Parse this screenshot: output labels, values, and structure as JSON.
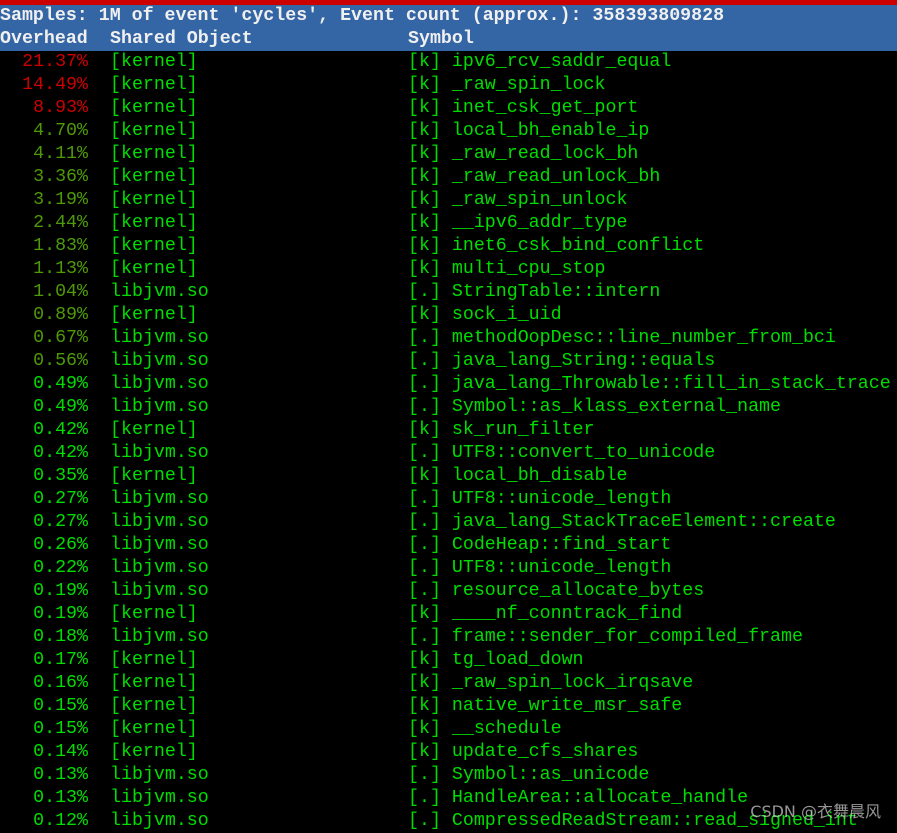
{
  "header": {
    "summary": "Samples: 1M of event 'cycles', Event count (approx.): 358393809828",
    "columns": [
      "Overhead",
      "Shared Object",
      "Symbol"
    ]
  },
  "colors": {
    "high": "#cc0000",
    "medium": "#4e9a06",
    "low": "#00dd00",
    "header_bg": "#3465a4",
    "titlebar": "#cc0000"
  },
  "rows": [
    {
      "overhead": "21.37%",
      "object": "[kernel]",
      "symbol": "[k] ipv6_rcv_saddr_equal"
    },
    {
      "overhead": "14.49%",
      "object": "[kernel]",
      "symbol": "[k] _raw_spin_lock"
    },
    {
      "overhead": "8.93%",
      "object": "[kernel]",
      "symbol": "[k] inet_csk_get_port"
    },
    {
      "overhead": "4.70%",
      "object": "[kernel]",
      "symbol": "[k] local_bh_enable_ip"
    },
    {
      "overhead": "4.11%",
      "object": "[kernel]",
      "symbol": "[k] _raw_read_lock_bh"
    },
    {
      "overhead": "3.36%",
      "object": "[kernel]",
      "symbol": "[k] _raw_read_unlock_bh"
    },
    {
      "overhead": "3.19%",
      "object": "[kernel]",
      "symbol": "[k] _raw_spin_unlock"
    },
    {
      "overhead": "2.44%",
      "object": "[kernel]",
      "symbol": "[k] __ipv6_addr_type"
    },
    {
      "overhead": "1.83%",
      "object": "[kernel]",
      "symbol": "[k] inet6_csk_bind_conflict"
    },
    {
      "overhead": "1.13%",
      "object": "[kernel]",
      "symbol": "[k] multi_cpu_stop"
    },
    {
      "overhead": "1.04%",
      "object": "libjvm.so",
      "symbol": "[.] StringTable::intern"
    },
    {
      "overhead": "0.89%",
      "object": "[kernel]",
      "symbol": "[k] sock_i_uid"
    },
    {
      "overhead": "0.67%",
      "object": "libjvm.so",
      "symbol": "[.] methodOopDesc::line_number_from_bci"
    },
    {
      "overhead": "0.56%",
      "object": "libjvm.so",
      "symbol": "[.] java_lang_String::equals"
    },
    {
      "overhead": "0.49%",
      "object": "libjvm.so",
      "symbol": "[.] java_lang_Throwable::fill_in_stack_trace"
    },
    {
      "overhead": "0.49%",
      "object": "libjvm.so",
      "symbol": "[.] Symbol::as_klass_external_name"
    },
    {
      "overhead": "0.42%",
      "object": "[kernel]",
      "symbol": "[k] sk_run_filter"
    },
    {
      "overhead": "0.42%",
      "object": "libjvm.so",
      "symbol": "[.] UTF8::convert_to_unicode"
    },
    {
      "overhead": "0.35%",
      "object": "[kernel]",
      "symbol": "[k] local_bh_disable"
    },
    {
      "overhead": "0.27%",
      "object": "libjvm.so",
      "symbol": "[.] UTF8::unicode_length"
    },
    {
      "overhead": "0.27%",
      "object": "libjvm.so",
      "symbol": "[.] java_lang_StackTraceElement::create"
    },
    {
      "overhead": "0.26%",
      "object": "libjvm.so",
      "symbol": "[.] CodeHeap::find_start"
    },
    {
      "overhead": "0.22%",
      "object": "libjvm.so",
      "symbol": "[.] UTF8::unicode_length"
    },
    {
      "overhead": "0.19%",
      "object": "libjvm.so",
      "symbol": "[.] resource_allocate_bytes"
    },
    {
      "overhead": "0.19%",
      "object": "[kernel]",
      "symbol": "[k] ____nf_conntrack_find"
    },
    {
      "overhead": "0.18%",
      "object": "libjvm.so",
      "symbol": "[.] frame::sender_for_compiled_frame"
    },
    {
      "overhead": "0.17%",
      "object": "[kernel]",
      "symbol": "[k] tg_load_down"
    },
    {
      "overhead": "0.16%",
      "object": "[kernel]",
      "symbol": "[k] _raw_spin_lock_irqsave"
    },
    {
      "overhead": "0.15%",
      "object": "[kernel]",
      "symbol": "[k] native_write_msr_safe"
    },
    {
      "overhead": "0.15%",
      "object": "[kernel]",
      "symbol": "[k] __schedule"
    },
    {
      "overhead": "0.14%",
      "object": "[kernel]",
      "symbol": "[k] update_cfs_shares"
    },
    {
      "overhead": "0.13%",
      "object": "libjvm.so",
      "symbol": "[.] Symbol::as_unicode"
    },
    {
      "overhead": "0.13%",
      "object": "libjvm.so",
      "symbol": "[.] HandleArea::allocate_handle"
    },
    {
      "overhead": "0.12%",
      "object": "libjvm.so",
      "symbol": "[.] CompressedReadStream::read_signed_int"
    }
  ],
  "watermark": "CSDN @衣舞晨风"
}
